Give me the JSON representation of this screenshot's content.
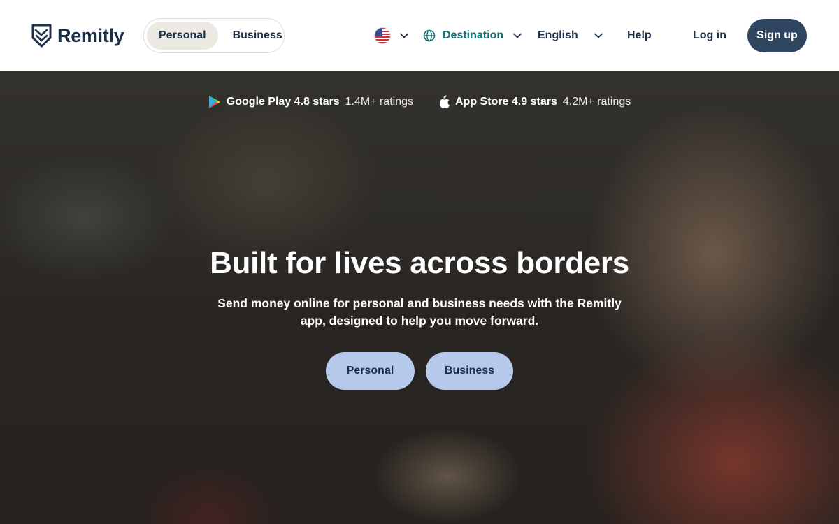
{
  "brand": {
    "name": "Remitly",
    "color": "#1b3049"
  },
  "header": {
    "segment": {
      "personal": "Personal",
      "business": "Business",
      "active": "Personal"
    },
    "country": {
      "flag": "us-flag-icon"
    },
    "destination": {
      "label": "Destination",
      "color": "#0e6e72"
    },
    "language": "English",
    "help": "Help",
    "login": "Log in",
    "signup": "Sign up"
  },
  "hero": {
    "ratings": [
      {
        "store": "Google Play",
        "score": "4.8 stars",
        "count": "1.4M+ ratings",
        "icon": "google-play-icon"
      },
      {
        "store": "App Store",
        "score": "4.9 stars",
        "count": "4.2M+ ratings",
        "icon": "apple-icon"
      }
    ],
    "title": "Built for lives across borders",
    "subtitle": "Send money online for personal and business needs with the Remitly app, designed to help you move forward.",
    "cta_personal": "Personal",
    "cta_business": "Business",
    "cta_color": "#b6cbec"
  }
}
